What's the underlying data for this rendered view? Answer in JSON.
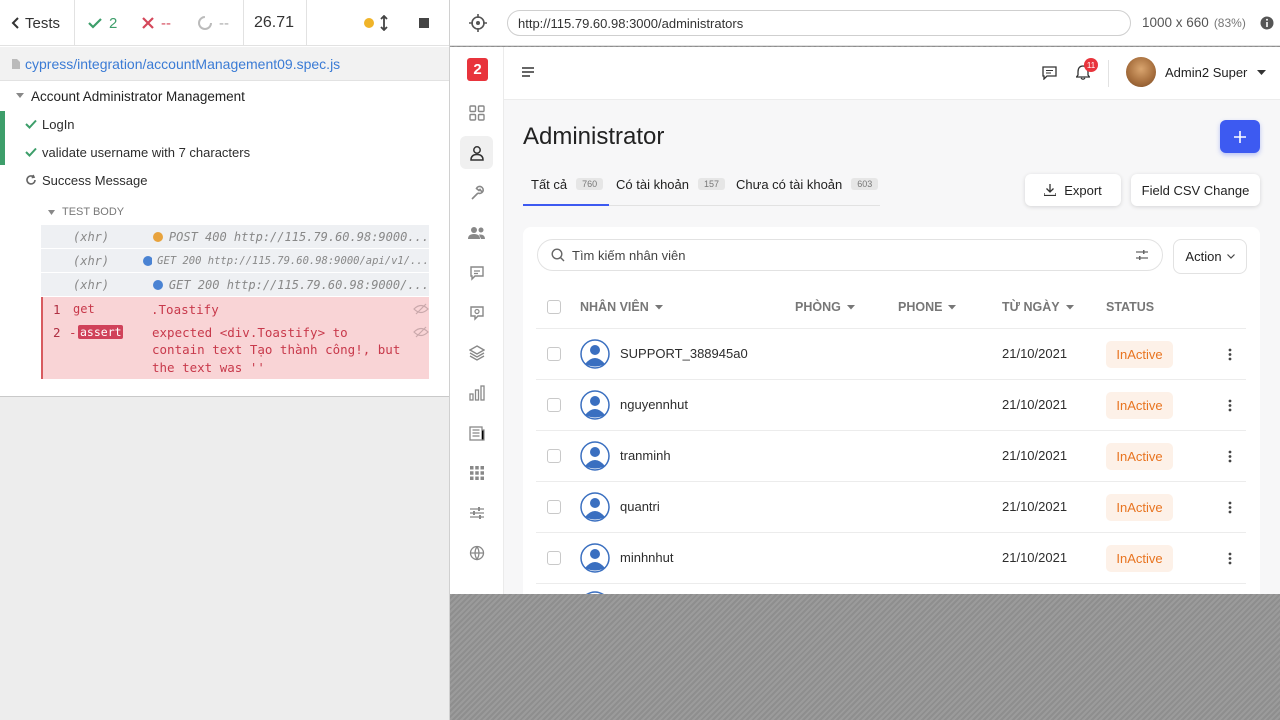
{
  "runner": {
    "back_label": "Tests",
    "passed": "2",
    "failed": "--",
    "pending": "--",
    "duration": "26.71",
    "spec_path": "cypress/integration/accountManagement09.spec.js",
    "suite_title": "Account Administrator Management",
    "tests": [
      {
        "title": "LogIn",
        "state": "passed"
      },
      {
        "title": "validate username with 7 characters",
        "state": "passed"
      },
      {
        "title": "Success Message",
        "state": "running"
      }
    ],
    "section_label": "TEST BODY",
    "commands": [
      {
        "type": "(xhr)",
        "text": "POST 400 http://115.79.60.98:9000...",
        "dot_color": "#e8a33d"
      },
      {
        "type": "(xhr)",
        "text": "GET 200 http://115.79.60.98:9000/api/v1/...",
        "dot_color": "#4a83d3"
      },
      {
        "type": "(xhr)",
        "text": "GET 200 http://115.79.60.98:9000/...",
        "dot_color": "#4a83d3"
      }
    ],
    "error_steps": [
      {
        "num": "1",
        "name": "get",
        "message": ".Toastify"
      },
      {
        "num": "2",
        "prefix": "-",
        "name": "assert",
        "line1": "expected <div.Toastify> to",
        "line2": "contain text Tạo thành công!, but",
        "line3": "the text was ''"
      }
    ]
  },
  "browser": {
    "url": "http://115.79.60.98:3000/administrators",
    "viewport": "1000 x 660",
    "scale": "(83%)"
  },
  "app": {
    "logo_text": "2",
    "notification_count": "11",
    "user_name": "Admin2 Super",
    "page_title": "Administrator",
    "tabs": [
      {
        "label": "Tất cả",
        "count": "760",
        "active": true
      },
      {
        "label": "Có tài khoản",
        "count": "157"
      },
      {
        "label": "Chưa có tài khoản",
        "count": "603"
      }
    ],
    "export_label": "Export",
    "csv_label": "Field CSV Change",
    "search_placeholder": "Tìm kiếm nhân viên",
    "action_label": "Action",
    "columns": [
      "NHÂN VIÊN",
      "PHÒNG",
      "PHONE",
      "TỪ NGÀY",
      "STATUS"
    ],
    "rows": [
      {
        "name": "SUPPORT_388945a0",
        "date": "21/10/2021",
        "status": "InActive"
      },
      {
        "name": "nguyennhut",
        "date": "21/10/2021",
        "status": "InActive"
      },
      {
        "name": "tranminh",
        "date": "21/10/2021",
        "status": "InActive"
      },
      {
        "name": "quantri",
        "date": "21/10/2021",
        "status": "InActive"
      },
      {
        "name": "minhnhut",
        "date": "21/10/2021",
        "status": "InActive"
      }
    ],
    "colors": {
      "primary": "#3d5af1",
      "status_text": "#e87420",
      "status_bg": "#fdf1e8",
      "logo_bg": "#e8343c"
    }
  }
}
